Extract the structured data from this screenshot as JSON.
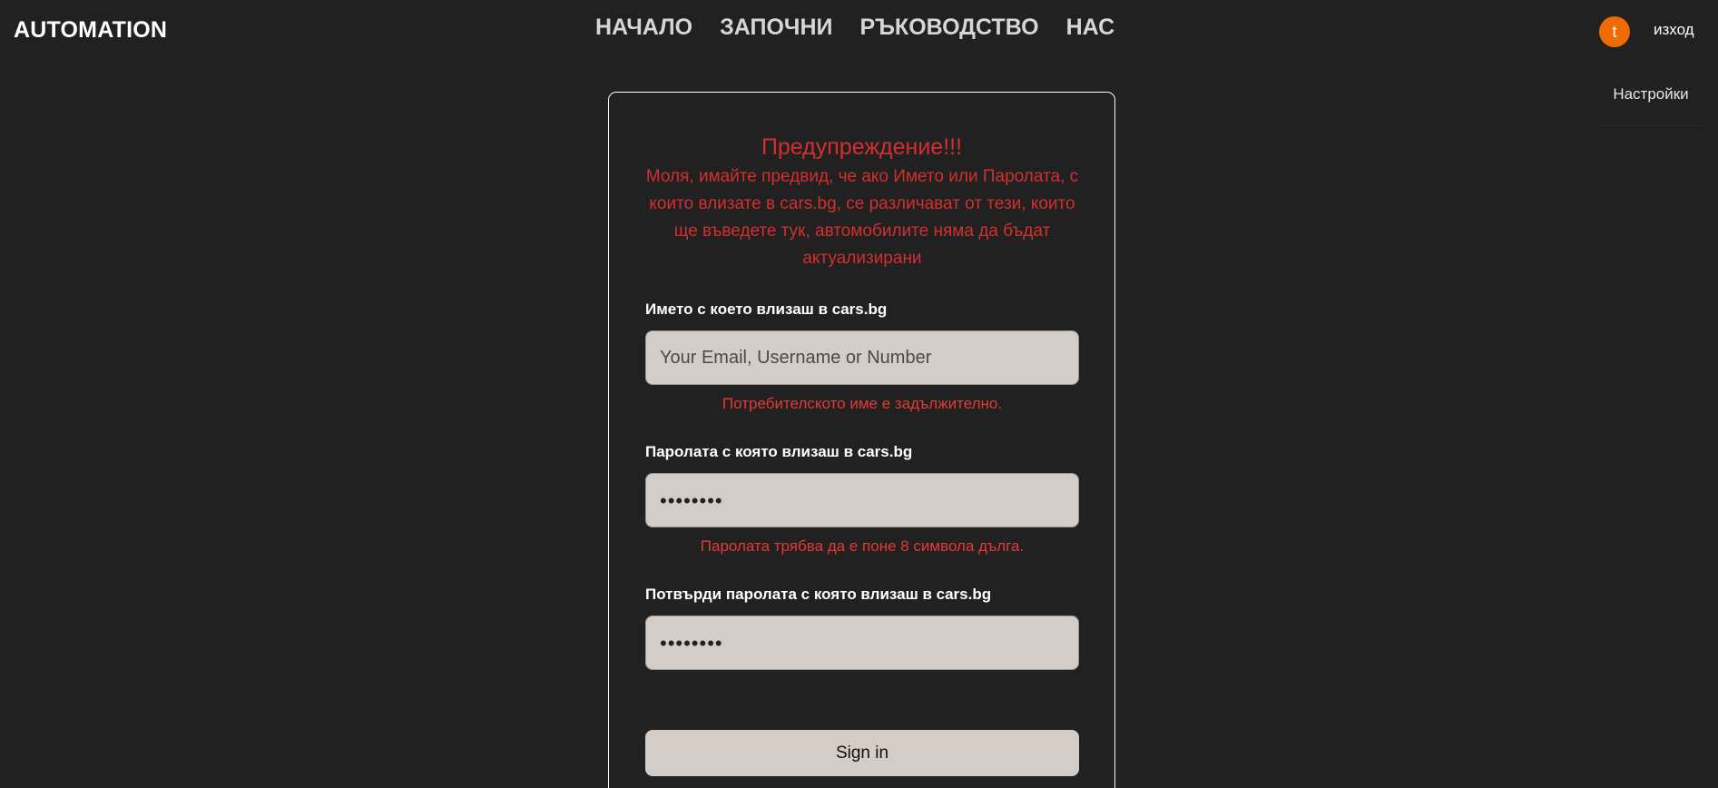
{
  "header": {
    "brand": "AUTOMATION",
    "nav": [
      {
        "label": "НАЧАЛО"
      },
      {
        "label": "ЗАПОЧНИ"
      },
      {
        "label": "РЪКОВОДСТВО"
      },
      {
        "label": "НАС"
      }
    ],
    "avatar_initial": "t",
    "avatar_color": "#ef6c00",
    "logout_label": "изход",
    "dropdown": {
      "items": [
        {
          "label": "Настройки"
        }
      ]
    }
  },
  "form": {
    "warning_title": "Предупреждение!!!",
    "warning_text": "Моля, имайте предвид, че ако Името или Паролата, с които влизате в cars.bg, се различават от тези, които ще въведете тук, автомобилите няма да бъдат актуализирани",
    "username": {
      "label": "Името с което влизаш в cars.bg",
      "placeholder": "Your Email, Username or Number",
      "value": "",
      "error": "Потребителското име е задължително."
    },
    "password": {
      "label": "Паролата с която влизаш в cars.bg",
      "value": "••••••••",
      "error": "Паролата трябва да е поне 8 символа дълга."
    },
    "confirm_password": {
      "label": "Потвърди паролата с която влизаш в cars.bg",
      "value": "••••••••"
    },
    "submit_label": "Sign in"
  },
  "colors": {
    "background": "#212121",
    "warning": "#d32f2f",
    "input_bg": "#d4ccc6"
  }
}
